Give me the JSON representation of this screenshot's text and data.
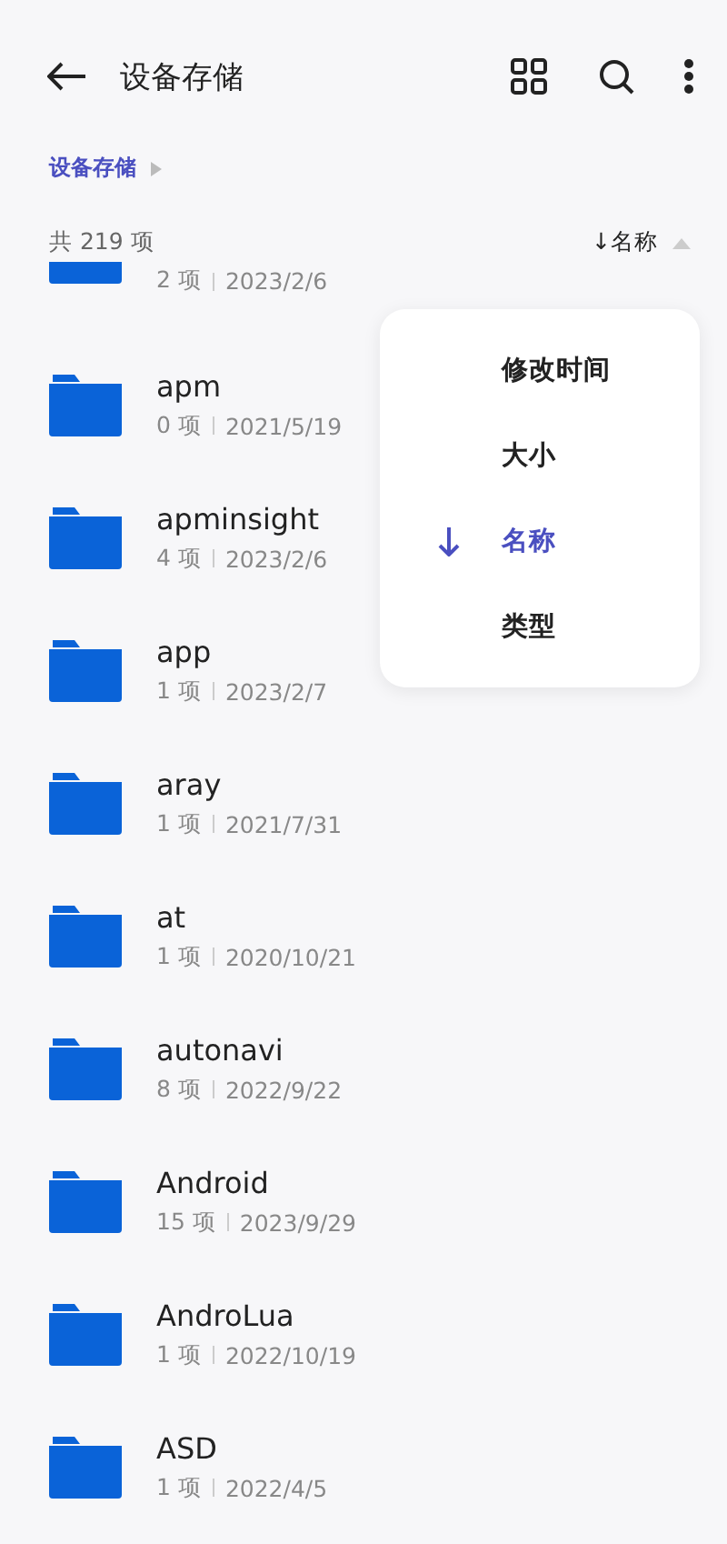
{
  "header": {
    "title": "设备存储"
  },
  "breadcrumb": {
    "label": "设备存储"
  },
  "summary": {
    "count": "共 219 项",
    "sort": "↓名称"
  },
  "files": [
    {
      "kind": "partial",
      "count": "2 项",
      "date": "2023/2/6"
    },
    {
      "kind": "full",
      "name": "apm",
      "count": "0 项",
      "date": "2021/5/19"
    },
    {
      "kind": "full",
      "name": "apminsight",
      "count": "4 项",
      "date": "2023/2/6"
    },
    {
      "kind": "full",
      "name": "app",
      "count": "1 项",
      "date": "2023/2/7"
    },
    {
      "kind": "full",
      "name": "aray",
      "count": "1 项",
      "date": "2021/7/31"
    },
    {
      "kind": "full",
      "name": "at",
      "count": "1 项",
      "date": "2020/10/21"
    },
    {
      "kind": "full",
      "name": "autonavi",
      "count": "8 项",
      "date": "2022/9/22"
    },
    {
      "kind": "full",
      "name": "Android",
      "count": "15 项",
      "date": "2023/9/29"
    },
    {
      "kind": "full",
      "name": "AndroLua",
      "count": "1 项",
      "date": "2022/10/19"
    },
    {
      "kind": "full",
      "name": "ASD",
      "count": "1 项",
      "date": "2022/4/5"
    }
  ],
  "sort_menu": [
    {
      "label": "修改时间",
      "selected": false
    },
    {
      "label": "大小",
      "selected": false
    },
    {
      "label": "名称",
      "selected": true
    },
    {
      "label": "类型",
      "selected": false
    }
  ]
}
